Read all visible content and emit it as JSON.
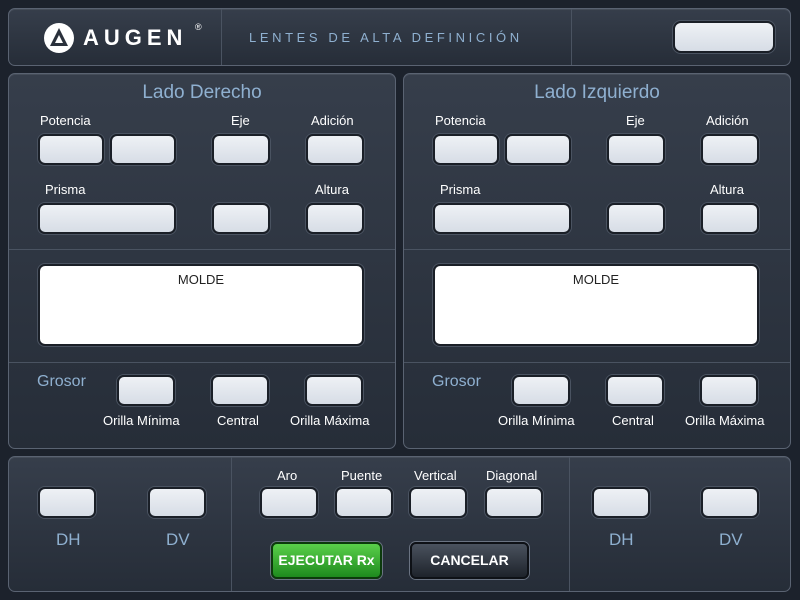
{
  "header": {
    "brand": "AUGEN",
    "brand_mark": "®",
    "logo_icon": "triangle-circle-icon",
    "tagline": "LENTES DE ALTA DEFINICIÓN",
    "corner_field": ""
  },
  "right_side": {
    "title": "Lado Derecho",
    "power_label": "Potencia",
    "axis_label": "Eje",
    "addition_label": "Adición",
    "prism_label": "Prisma",
    "height_label": "Altura",
    "mold_label": "MOLDE",
    "thickness_label": "Grosor",
    "min_edge_label": "Orilla Mínima",
    "center_label": "Central",
    "max_edge_label": "Orilla Máxima"
  },
  "left_side": {
    "title": "Lado Izquierdo",
    "power_label": "Potencia",
    "axis_label": "Eje",
    "addition_label": "Adición",
    "prism_label": "Prisma",
    "height_label": "Altura",
    "mold_label": "MOLDE",
    "thickness_label": "Grosor",
    "min_edge_label": "Orilla Mínima",
    "center_label": "Central",
    "max_edge_label": "Orilla Máxima"
  },
  "bottom": {
    "dh_left": "DH",
    "dv_left": "DV",
    "frame_label": "Aro",
    "bridge_label": "Puente",
    "vertical_label": "Vertical",
    "diagonal_label": "Diagonal",
    "dh_right": "DH",
    "dv_right": "DV",
    "execute_label": "EJECUTAR Rx",
    "cancel_label": "CANCELAR"
  },
  "colors": {
    "accent_label": "#8fb0d0",
    "execute_button": "#2ea82a",
    "background": "#1c222c"
  }
}
